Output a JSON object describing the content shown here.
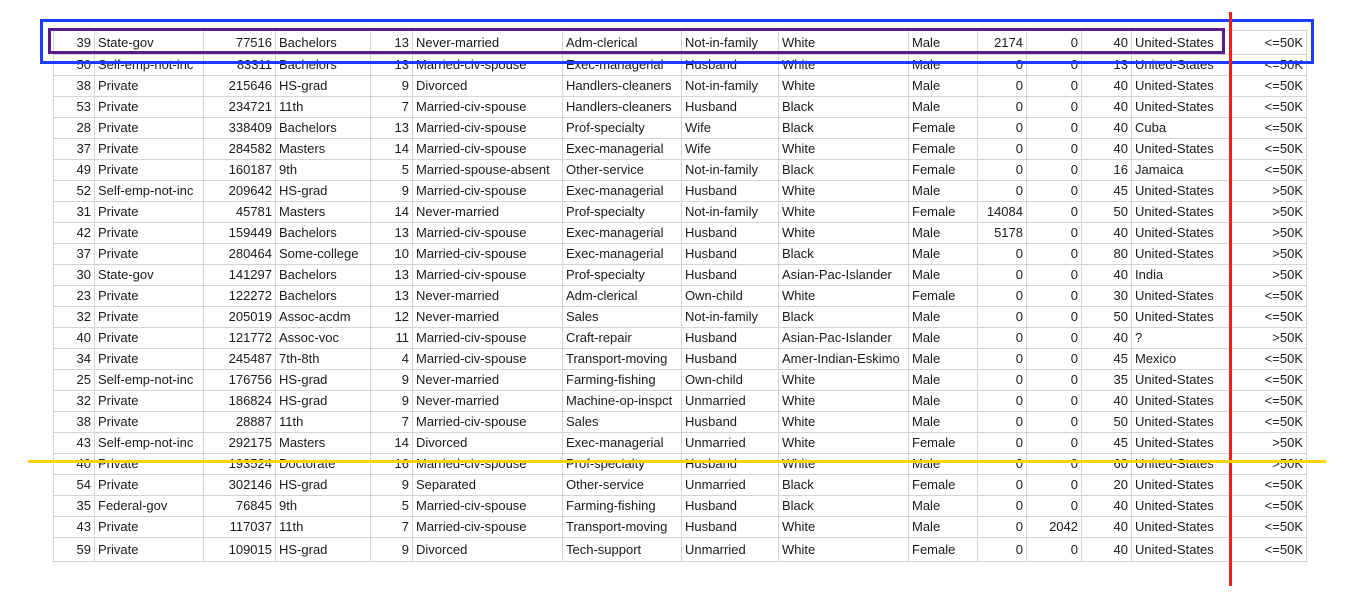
{
  "columns_numeric": [
    true,
    false,
    true,
    false,
    true,
    false,
    false,
    false,
    false,
    false,
    true,
    true,
    true,
    false,
    true
  ],
  "rows": [
    [
      "39",
      "State-gov",
      "77516",
      "Bachelors",
      "13",
      "Never-married",
      "Adm-clerical",
      "Not-in-family",
      "White",
      "Male",
      "2174",
      "0",
      "40",
      "United-States",
      "<=50K"
    ],
    [
      "50",
      "Self-emp-not-inc",
      "83311",
      "Bachelors",
      "13",
      "Married-civ-spouse",
      "Exec-managerial",
      "Husband",
      "White",
      "Male",
      "0",
      "0",
      "13",
      "United-States",
      "<=50K"
    ],
    [
      "38",
      "Private",
      "215646",
      "HS-grad",
      "9",
      "Divorced",
      "Handlers-cleaners",
      "Not-in-family",
      "White",
      "Male",
      "0",
      "0",
      "40",
      "United-States",
      "<=50K"
    ],
    [
      "53",
      "Private",
      "234721",
      "11th",
      "7",
      "Married-civ-spouse",
      "Handlers-cleaners",
      "Husband",
      "Black",
      "Male",
      "0",
      "0",
      "40",
      "United-States",
      "<=50K"
    ],
    [
      "28",
      "Private",
      "338409",
      "Bachelors",
      "13",
      "Married-civ-spouse",
      "Prof-specialty",
      "Wife",
      "Black",
      "Female",
      "0",
      "0",
      "40",
      "Cuba",
      "<=50K"
    ],
    [
      "37",
      "Private",
      "284582",
      "Masters",
      "14",
      "Married-civ-spouse",
      "Exec-managerial",
      "Wife",
      "White",
      "Female",
      "0",
      "0",
      "40",
      "United-States",
      "<=50K"
    ],
    [
      "49",
      "Private",
      "160187",
      "9th",
      "5",
      "Married-spouse-absent",
      "Other-service",
      "Not-in-family",
      "Black",
      "Female",
      "0",
      "0",
      "16",
      "Jamaica",
      "<=50K"
    ],
    [
      "52",
      "Self-emp-not-inc",
      "209642",
      "HS-grad",
      "9",
      "Married-civ-spouse",
      "Exec-managerial",
      "Husband",
      "White",
      "Male",
      "0",
      "0",
      "45",
      "United-States",
      ">50K"
    ],
    [
      "31",
      "Private",
      "45781",
      "Masters",
      "14",
      "Never-married",
      "Prof-specialty",
      "Not-in-family",
      "White",
      "Female",
      "14084",
      "0",
      "50",
      "United-States",
      ">50K"
    ],
    [
      "42",
      "Private",
      "159449",
      "Bachelors",
      "13",
      "Married-civ-spouse",
      "Exec-managerial",
      "Husband",
      "White",
      "Male",
      "5178",
      "0",
      "40",
      "United-States",
      ">50K"
    ],
    [
      "37",
      "Private",
      "280464",
      "Some-college",
      "10",
      "Married-civ-spouse",
      "Exec-managerial",
      "Husband",
      "Black",
      "Male",
      "0",
      "0",
      "80",
      "United-States",
      ">50K"
    ],
    [
      "30",
      "State-gov",
      "141297",
      "Bachelors",
      "13",
      "Married-civ-spouse",
      "Prof-specialty",
      "Husband",
      "Asian-Pac-Islander",
      "Male",
      "0",
      "0",
      "40",
      "India",
      ">50K"
    ],
    [
      "23",
      "Private",
      "122272",
      "Bachelors",
      "13",
      "Never-married",
      "Adm-clerical",
      "Own-child",
      "White",
      "Female",
      "0",
      "0",
      "30",
      "United-States",
      "<=50K"
    ],
    [
      "32",
      "Private",
      "205019",
      "Assoc-acdm",
      "12",
      "Never-married",
      "Sales",
      "Not-in-family",
      "Black",
      "Male",
      "0",
      "0",
      "50",
      "United-States",
      "<=50K"
    ],
    [
      "40",
      "Private",
      "121772",
      "Assoc-voc",
      "11",
      "Married-civ-spouse",
      "Craft-repair",
      "Husband",
      "Asian-Pac-Islander",
      "Male",
      "0",
      "0",
      "40",
      "?",
      ">50K"
    ],
    [
      "34",
      "Private",
      "245487",
      "7th-8th",
      "4",
      "Married-civ-spouse",
      "Transport-moving",
      "Husband",
      "Amer-Indian-Eskimo",
      "Male",
      "0",
      "0",
      "45",
      "Mexico",
      "<=50K"
    ],
    [
      "25",
      "Self-emp-not-inc",
      "176756",
      "HS-grad",
      "9",
      "Never-married",
      "Farming-fishing",
      "Own-child",
      "White",
      "Male",
      "0",
      "0",
      "35",
      "United-States",
      "<=50K"
    ],
    [
      "32",
      "Private",
      "186824",
      "HS-grad",
      "9",
      "Never-married",
      "Machine-op-inspct",
      "Unmarried",
      "White",
      "Male",
      "0",
      "0",
      "40",
      "United-States",
      "<=50K"
    ],
    [
      "38",
      "Private",
      "28887",
      "11th",
      "7",
      "Married-civ-spouse",
      "Sales",
      "Husband",
      "White",
      "Male",
      "0",
      "0",
      "50",
      "United-States",
      "<=50K"
    ],
    [
      "43",
      "Self-emp-not-inc",
      "292175",
      "Masters",
      "14",
      "Divorced",
      "Exec-managerial",
      "Unmarried",
      "White",
      "Female",
      "0",
      "0",
      "45",
      "United-States",
      ">50K"
    ],
    [
      "40",
      "Private",
      "193524",
      "Doctorate",
      "16",
      "Married-civ-spouse",
      "Prof-specialty",
      "Husband",
      "White",
      "Male",
      "0",
      "0",
      "60",
      "United-States",
      ">50K"
    ],
    [
      "54",
      "Private",
      "302146",
      "HS-grad",
      "9",
      "Separated",
      "Other-service",
      "Unmarried",
      "Black",
      "Female",
      "0",
      "0",
      "20",
      "United-States",
      "<=50K"
    ],
    [
      "35",
      "Federal-gov",
      "76845",
      "9th",
      "5",
      "Married-civ-spouse",
      "Farming-fishing",
      "Husband",
      "Black",
      "Male",
      "0",
      "0",
      "40",
      "United-States",
      "<=50K"
    ],
    [
      "43",
      "Private",
      "117037",
      "11th",
      "7",
      "Married-civ-spouse",
      "Transport-moving",
      "Husband",
      "White",
      "Male",
      "0",
      "2042",
      "40",
      "United-States",
      "<=50K"
    ],
    [
      "59",
      "Private",
      "109015",
      "HS-grad",
      "9",
      "Divorced",
      "Tech-support",
      "Unmarried",
      "White",
      "Female",
      "0",
      "0",
      "40",
      "United-States",
      "<=50K"
    ]
  ],
  "annotations": {
    "blue_box_color": "#1a3cff",
    "purple_box_color": "#5a1a8a",
    "red_line_color": "#ff1a1a",
    "yellow_line_color": "#ffd400"
  }
}
